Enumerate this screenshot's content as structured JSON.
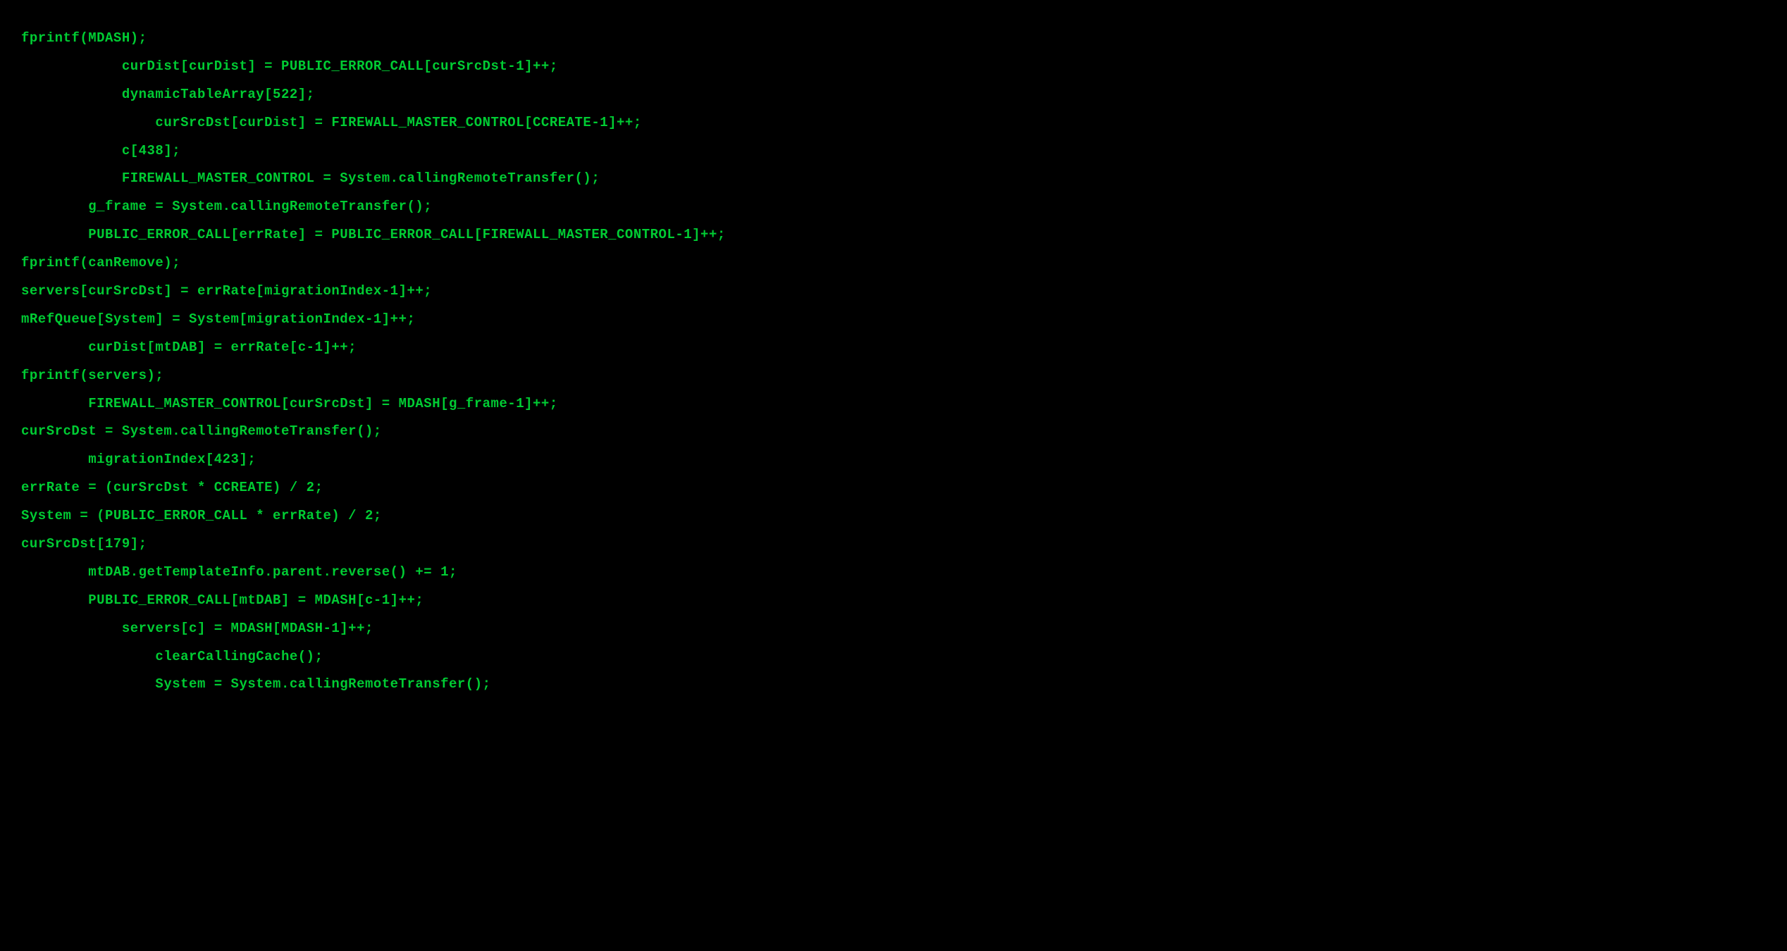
{
  "code": {
    "lines": [
      "fprintf(MDASH);",
      "            curDist[curDist] = PUBLIC_ERROR_CALL[curSrcDst-1]++;",
      "            dynamicTableArray[522];",
      "                curSrcDst[curDist] = FIREWALL_MASTER_CONTROL[CCREATE-1]++;",
      "            c[438];",
      "            FIREWALL_MASTER_CONTROL = System.callingRemoteTransfer();",
      "        g_frame = System.callingRemoteTransfer();",
      "        PUBLIC_ERROR_CALL[errRate] = PUBLIC_ERROR_CALL[FIREWALL_MASTER_CONTROL-1]++;",
      "fprintf(canRemove);",
      "servers[curSrcDst] = errRate[migrationIndex-1]++;",
      "mRefQueue[System] = System[migrationIndex-1]++;",
      "        curDist[mtDAB] = errRate[c-1]++;",
      "fprintf(servers);",
      "        FIREWALL_MASTER_CONTROL[curSrcDst] = MDASH[g_frame-1]++;",
      "curSrcDst = System.callingRemoteTransfer();",
      "        migrationIndex[423];",
      "errRate = (curSrcDst * CCREATE) / 2;",
      "System = (PUBLIC_ERROR_CALL * errRate) / 2;",
      "curSrcDst[179];",
      "        mtDAB.getTemplateInfo.parent.reverse() += 1;",
      "        PUBLIC_ERROR_CALL[mtDAB] = MDASH[c-1]++;",
      "            servers[c] = MDASH[MDASH-1]++;",
      "                clearCallingCache();",
      "                System = System.callingRemoteTransfer();"
    ]
  }
}
